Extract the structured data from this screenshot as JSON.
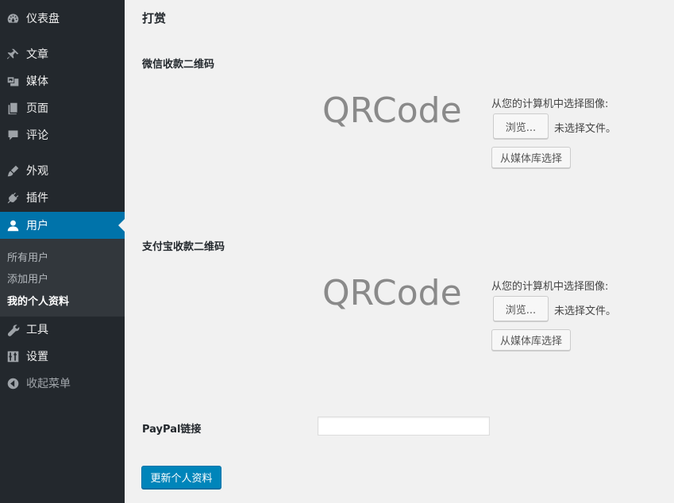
{
  "sidebar": {
    "items": [
      {
        "label": "仪表盘",
        "icon": "dashboard-icon"
      },
      {
        "label": "文章",
        "icon": "pin-icon"
      },
      {
        "label": "媒体",
        "icon": "media-icon"
      },
      {
        "label": "页面",
        "icon": "page-icon"
      },
      {
        "label": "评论",
        "icon": "comment-icon"
      },
      {
        "label": "外观",
        "icon": "brush-icon"
      },
      {
        "label": "插件",
        "icon": "plugin-icon"
      },
      {
        "label": "用户",
        "icon": "user-icon",
        "active": true
      },
      {
        "label": "工具",
        "icon": "wrench-icon"
      },
      {
        "label": "设置",
        "icon": "settings-icon"
      },
      {
        "label": "收起菜单",
        "icon": "collapse-icon"
      }
    ],
    "submenu": [
      {
        "label": "所有用户"
      },
      {
        "label": "添加用户"
      },
      {
        "label": "我的个人资料",
        "current": true
      }
    ]
  },
  "main": {
    "section_title": "打赏",
    "wechat": {
      "label": "微信收款二维码",
      "qrcode_text": "QRCode",
      "upload_label": "从您的计算机中选择图像:",
      "browse_button": "浏览...",
      "no_file": "未选择文件。",
      "library_button": "从媒体库选择"
    },
    "alipay": {
      "label": "支付宝收款二维码",
      "qrcode_text": "QRCode",
      "upload_label": "从您的计算机中选择图像:",
      "browse_button": "浏览...",
      "no_file": "未选择文件。",
      "library_button": "从媒体库选择"
    },
    "paypal": {
      "label": "PayPal链接",
      "value": ""
    },
    "submit_button": "更新个人资料"
  },
  "colors": {
    "sidebar_bg": "#23282d",
    "active_bg": "#0073aa",
    "submenu_bg": "#32373c",
    "primary_button": "#0085ba",
    "page_bg": "#f1f1f1"
  }
}
